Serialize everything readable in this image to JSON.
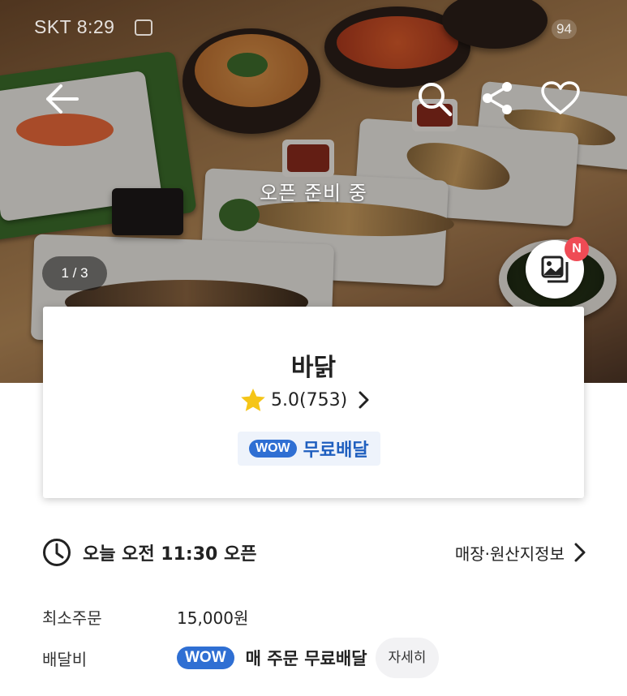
{
  "status_bar": {
    "carrier_time": "SKT 8:29",
    "battery": "94"
  },
  "hero": {
    "open_status": "오픈 준비 중",
    "photo_counter": "1 / 3",
    "new_badge": "N"
  },
  "icons": {
    "back": "back-arrow-icon",
    "search": "search-icon",
    "share": "share-icon",
    "favorite": "heart-icon",
    "photos": "photo-review-icon"
  },
  "store": {
    "name": "바닭",
    "rating": "5.0",
    "review_count": "(753)",
    "wow_label": "WOW",
    "delivery_badge": "무료배달"
  },
  "hours": {
    "text": "오늘 오전 11:30 오픈",
    "info_link": "매장·원산지정보"
  },
  "details": {
    "min_order_label": "최소주문",
    "min_order_value": "15,000원",
    "delivery_fee_label": "배달비",
    "wow_label": "WOW",
    "delivery_fee_value": "매 주문 무료배달",
    "detail_button": "자세히"
  },
  "colors": {
    "accent_blue": "#2f6fd3",
    "badge_red": "#ef4b55",
    "star": "#f5c518"
  }
}
